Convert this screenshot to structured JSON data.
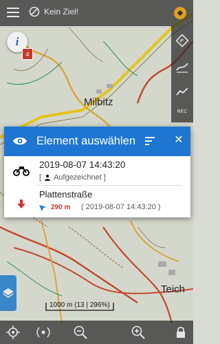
{
  "topbar": {
    "menu_icon": "hamburger-menu-icon",
    "no_route_label": "Kein Ziel!",
    "no_route_icon": "no-route-icon",
    "satellite_icon": "gps-satellite-icon"
  },
  "rightbar": {
    "icons": [
      "route-sign-icon",
      "track-line-icon",
      "graph-icon",
      "rec-icon"
    ],
    "rec_label": "REC"
  },
  "map": {
    "info_button_label": "i",
    "info_badge_count": "4",
    "town_labels": [
      "Milbitz",
      "Teich"
    ]
  },
  "dialog": {
    "title": "Element auswählen",
    "items": [
      {
        "title": "2019-08-07 14:43:20",
        "subtitle_open": "[",
        "subtitle_label": "Aufgezeichnet",
        "subtitle_close": "]",
        "icon": "motorbike-icon"
      },
      {
        "title": "Plattenstraße",
        "distance": "290 m",
        "date": "( 2019-08-07 14:43:20 )",
        "icon": "red-pin-icon"
      }
    ],
    "colors": {
      "header": "#1e76d2",
      "distance": "#c0392b"
    }
  },
  "scale": {
    "label": "1000 m (13 | 296%)"
  },
  "bottombar": {
    "icons": [
      "gps-target-icon",
      "compass-signal-icon",
      "zoom-out-icon",
      "zoom-in-icon",
      "lock-icon"
    ]
  }
}
